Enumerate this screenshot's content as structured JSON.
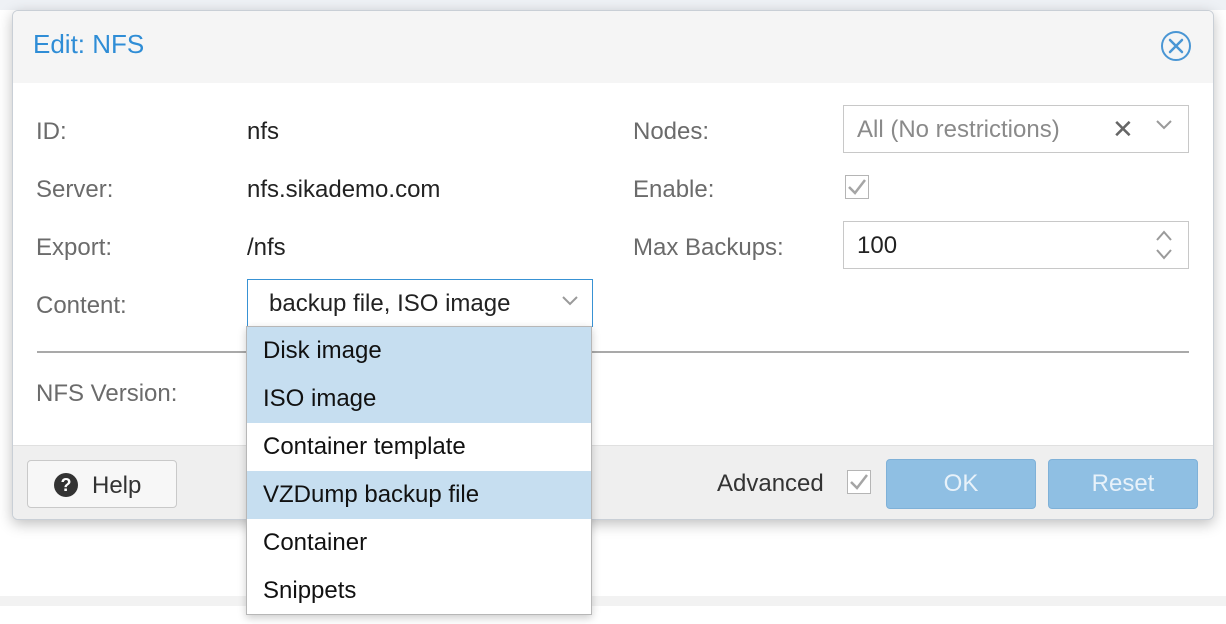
{
  "dialog": {
    "title": "Edit: NFS"
  },
  "form": {
    "id_label": "ID:",
    "id_value": "nfs",
    "server_label": "Server:",
    "server_value": "nfs.sikademo.com",
    "export_label": "Export:",
    "export_value": "/nfs",
    "content_label": "Content:",
    "content_value": "backup file, ISO image",
    "nodes_label": "Nodes:",
    "nodes_value": "All (No restrictions)",
    "enable_label": "Enable:",
    "enable_checked": true,
    "max_backups_label": "Max Backups:",
    "max_backups_value": "100",
    "nfs_version_label": "NFS Version:"
  },
  "content_dropdown": {
    "items": [
      {
        "label": "Disk image",
        "selected": true
      },
      {
        "label": "ISO image",
        "selected": true
      },
      {
        "label": "Container template",
        "selected": false
      },
      {
        "label": "VZDump backup file",
        "selected": true
      },
      {
        "label": "Container",
        "selected": false
      },
      {
        "label": "Snippets",
        "selected": false
      }
    ]
  },
  "footer": {
    "help_label": "Help",
    "advanced_label": "Advanced",
    "advanced_checked": true,
    "ok_label": "OK",
    "reset_label": "Reset"
  },
  "colors": {
    "accent": "#2f8dd6",
    "selected_item_bg": "#c6def0",
    "disabled_button_bg": "#8fbfe3"
  }
}
